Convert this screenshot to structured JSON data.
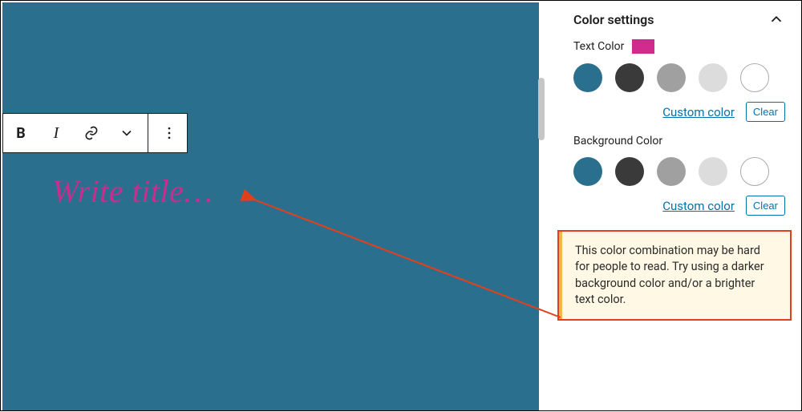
{
  "editor": {
    "title_placeholder": "Write title…"
  },
  "toolbar": {
    "bold": "B",
    "italic": "I"
  },
  "panel": {
    "title": "Color settings",
    "text_color": {
      "label": "Text Color",
      "indicator_color": "#d02b8d",
      "swatches": [
        "#2b6f8f",
        "#3a3a3a",
        "#a0a0a0",
        "#dcdcdc",
        "#ffffff"
      ],
      "custom_link": "Custom color",
      "clear": "Clear"
    },
    "bg_color": {
      "label": "Background Color",
      "swatches": [
        "#2b6f8f",
        "#3a3a3a",
        "#a0a0a0",
        "#dcdcdc",
        "#ffffff"
      ],
      "custom_link": "Custom color",
      "clear": "Clear"
    },
    "notice": "This color combination may be hard for people to read. Try using a darker background color and/or a brighter text color."
  }
}
